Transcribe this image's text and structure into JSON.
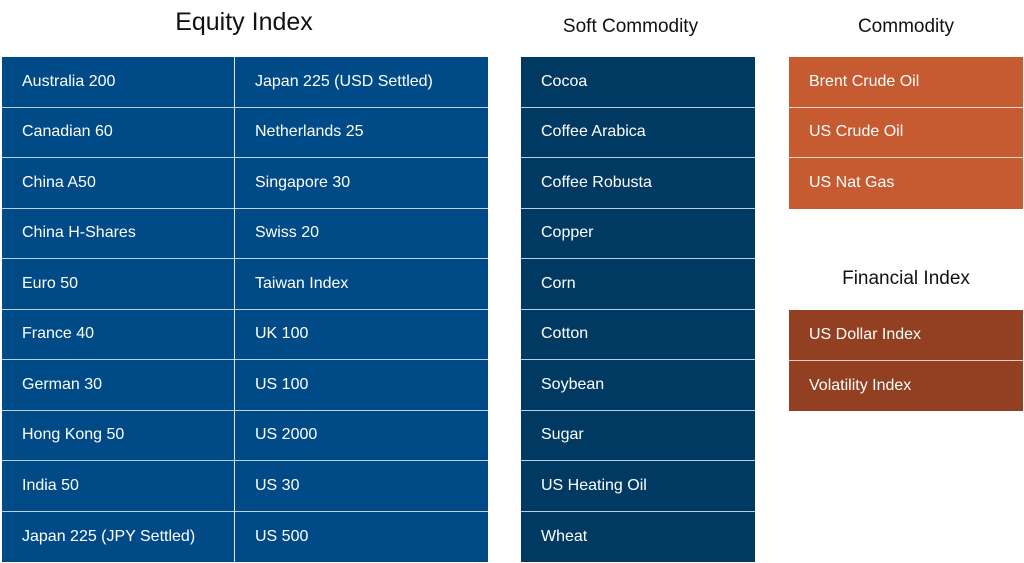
{
  "headings": {
    "equity": "Equity Index",
    "soft": "Soft Commodity",
    "commodity": "Commodity",
    "financial": "Financial Index"
  },
  "equity_left": [
    "Australia 200",
    "Canadian 60",
    "China A50",
    "China H-Shares",
    "Euro 50",
    "France 40",
    "German 30",
    "Hong Kong 50",
    "India 50",
    "Japan 225 (JPY Settled)"
  ],
  "equity_right": [
    "Japan 225 (USD Settled)",
    "Netherlands 25",
    "Singapore 30",
    "Swiss 20",
    "Taiwan Index",
    "UK 100",
    "US 100",
    "US 2000",
    "US 30",
    "US 500"
  ],
  "soft_commodity": [
    "Cocoa",
    "Coffee Arabica",
    "Coffee Robusta",
    "Copper",
    "Corn",
    "Cotton",
    "Soybean",
    "Sugar",
    "US Heating Oil",
    "Wheat"
  ],
  "commodity": [
    "Brent Crude Oil",
    "US Crude Oil",
    "US Nat Gas"
  ],
  "financial_index": [
    "US Dollar Index",
    "Volatility Index"
  ],
  "colors": {
    "equity": "#004b87",
    "soft": "#003a63",
    "commodity": "#c65a30",
    "financial": "#934022"
  }
}
